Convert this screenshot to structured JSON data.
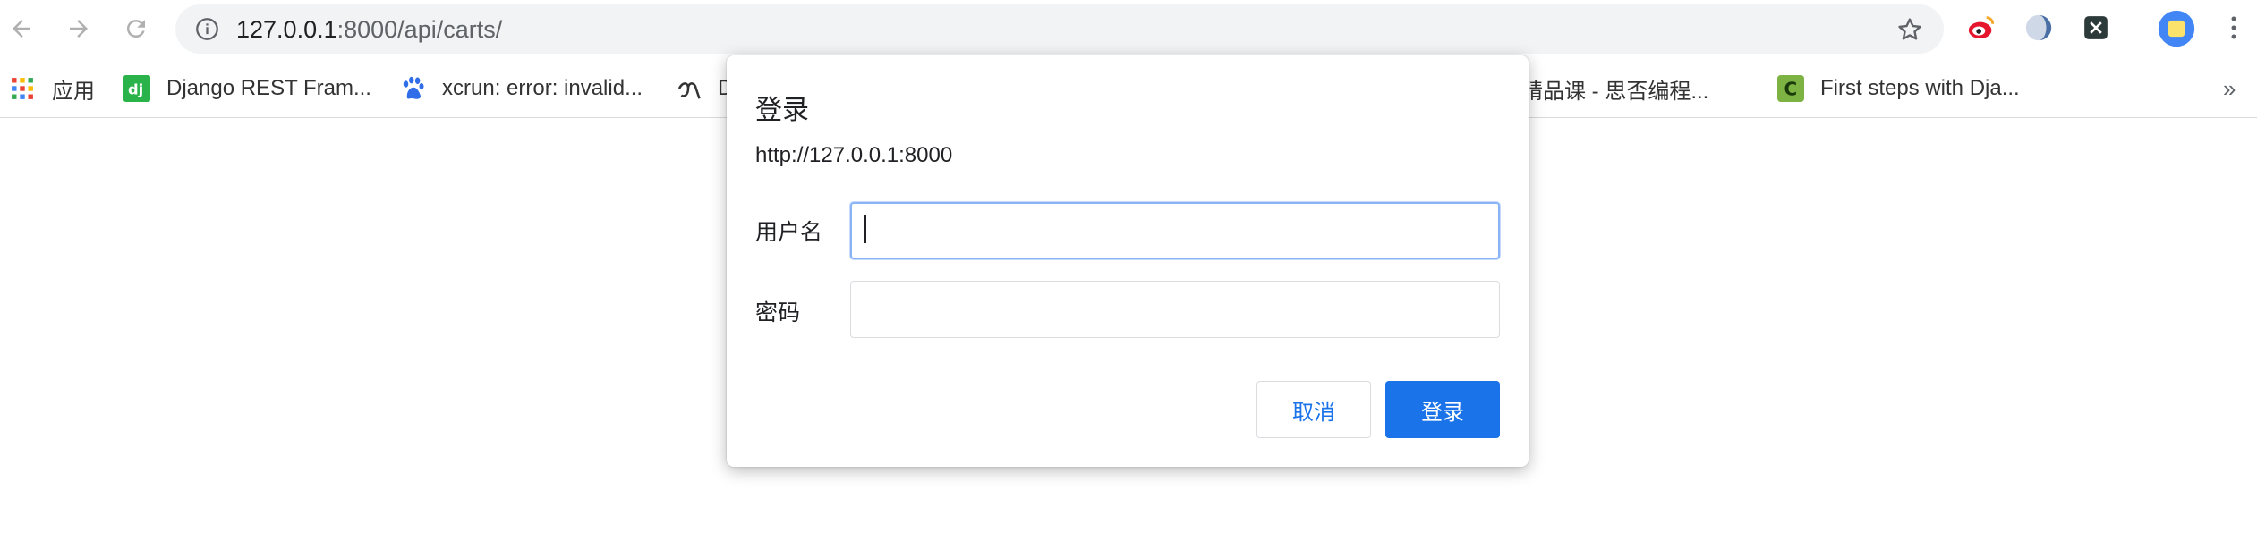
{
  "browser": {
    "url_host": "127.0.0.1",
    "url_rest": ":8000/api/carts/"
  },
  "bookmarks": {
    "apps_label": "应用",
    "items": [
      {
        "label": "Django REST Fram...",
        "icon": "django-icon"
      },
      {
        "label": "xcrun: error: invalid...",
        "icon": "baidu-paw-icon"
      },
      {
        "label": "D",
        "icon": "script-icon"
      },
      {
        "label": "精品课 - 思否编程...",
        "icon": "segmentfault-icon"
      },
      {
        "label": "First steps with Dja...",
        "icon": "c-book-icon"
      }
    ],
    "overflow": "»"
  },
  "dialog": {
    "title": "登录",
    "origin": "http://127.0.0.1:8000",
    "username_label": "用户名",
    "username_value": "",
    "password_label": "密码",
    "password_value": "",
    "cancel_label": "取消",
    "login_label": "登录"
  },
  "colors": {
    "accent": "#1a73e8",
    "focus_ring": "#8ab4f8",
    "omnibox_bg": "#f1f3f4",
    "django_green": "#2bb34b"
  }
}
